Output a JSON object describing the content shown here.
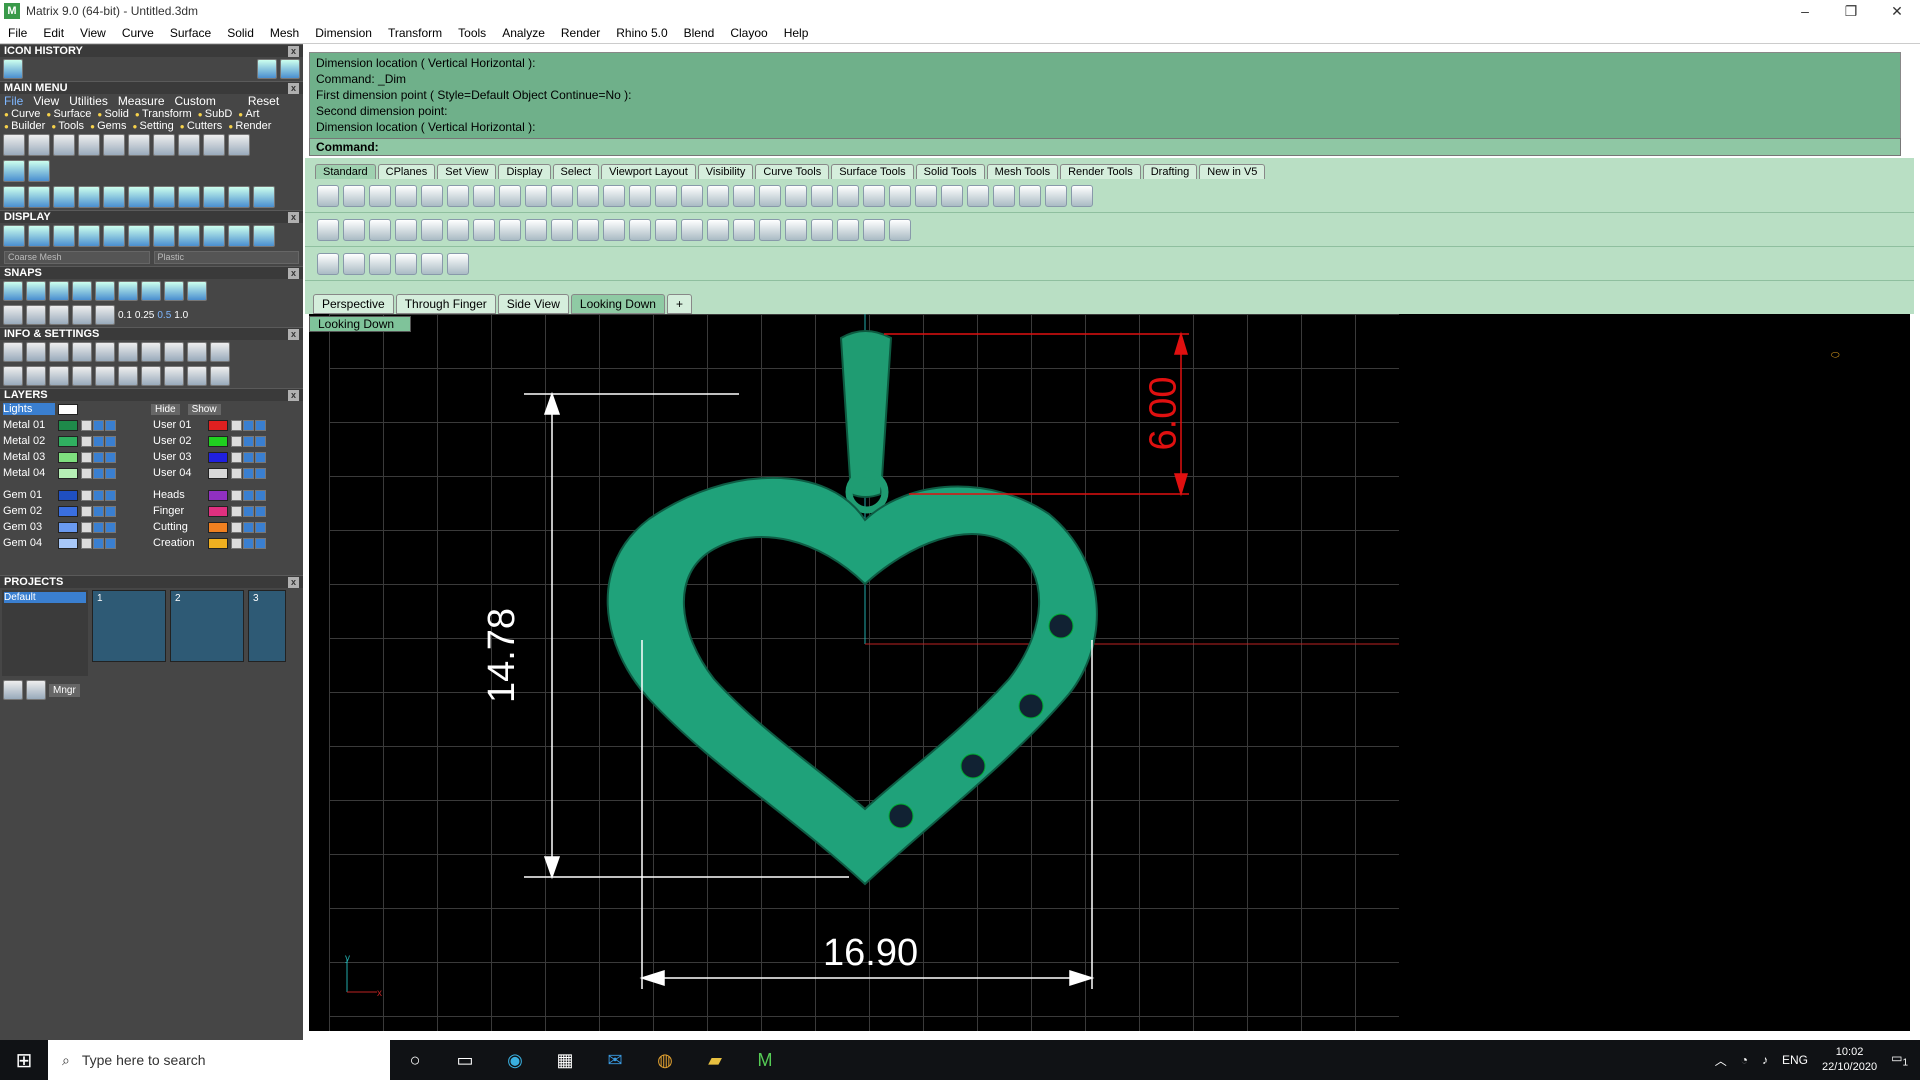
{
  "window": {
    "title": "Matrix 9.0 (64-bit) - Untitled.3dm",
    "app_icon": "matrix-app-icon"
  },
  "menu": [
    "File",
    "Edit",
    "View",
    "Curve",
    "Surface",
    "Solid",
    "Mesh",
    "Dimension",
    "Transform",
    "Tools",
    "Analyze",
    "Render",
    "Rhino 5.0",
    "Blend",
    "Clayoo",
    "Help"
  ],
  "panels": {
    "icon_history": "ICON HISTORY",
    "main_menu": "MAIN MENU",
    "main_menu_items": [
      "File",
      "View",
      "Utilities",
      "Measure",
      "Custom",
      "Reset"
    ],
    "options_row1": [
      "Curve",
      "Surface",
      "Solid",
      "Transform",
      "SubD",
      "Art"
    ],
    "options_row2": [
      "Builder",
      "Tools",
      "Gems",
      "Setting",
      "Cutters",
      "Render"
    ],
    "display": "DISPLAY",
    "mesh_select": "Coarse Mesh",
    "material_select": "Plastic",
    "snaps": "SNAPS",
    "snap_values": [
      "0.1",
      "0.25",
      "0.5",
      "1.0"
    ],
    "info_settings": "INFO & SETTINGS",
    "layers": "LAYERS",
    "lights": "Lights",
    "hide": "Hide",
    "show": "Show",
    "projects": "PROJECTS",
    "project_default": "Default",
    "mngr": "Mngr",
    "thumbs": [
      "1",
      "2",
      "3"
    ]
  },
  "layers_left": [
    {
      "name": "Metal 01",
      "color": "#1e8a4a"
    },
    {
      "name": "Metal 02",
      "color": "#30b060"
    },
    {
      "name": "Metal 03",
      "color": "#7fe07f"
    },
    {
      "name": "Metal 04",
      "color": "#b6f0b6"
    },
    {
      "name": "Gem 01",
      "color": "#1f4fc0"
    },
    {
      "name": "Gem 02",
      "color": "#3a6fe0"
    },
    {
      "name": "Gem 03",
      "color": "#6a9af0"
    },
    {
      "name": "Gem 04",
      "color": "#a8c8f8"
    }
  ],
  "layers_right": [
    {
      "name": "User 01",
      "color": "#e02020"
    },
    {
      "name": "User 02",
      "color": "#20d020"
    },
    {
      "name": "User 03",
      "color": "#2020e0"
    },
    {
      "name": "User 04",
      "color": "#d8d8d8"
    },
    {
      "name": "Heads",
      "color": "#9030c0"
    },
    {
      "name": "Finger",
      "color": "#e03080"
    },
    {
      "name": "Cutting",
      "color": "#f08020"
    },
    {
      "name": "Creation",
      "color": "#f0b020"
    }
  ],
  "command_history": [
    "Dimension location ( Vertical  Horizontal ):",
    "Command: _Dim",
    "First dimension point ( Style=Default  Object  Continue=No ):",
    "Second dimension point:",
    "Dimension location ( Vertical  Horizontal ):"
  ],
  "command_prompt": "Command:",
  "toolbar_tabs": [
    "Standard",
    "CPlanes",
    "Set View",
    "Display",
    "Select",
    "Viewport Layout",
    "Visibility",
    "Curve Tools",
    "Surface Tools",
    "Solid Tools",
    "Mesh Tools",
    "Render Tools",
    "Drafting",
    "New in V5"
  ],
  "view_tabs": [
    "Perspective",
    "Through Finger",
    "Side View",
    "Looking Down"
  ],
  "active_view": "Looking Down",
  "dimensions": {
    "height": "14.78",
    "width": "16.90",
    "bail": "6.00"
  },
  "axis": {
    "y": "y",
    "x": "x"
  },
  "taskbar": {
    "search_placeholder": "Type here to search",
    "lang": "ENG",
    "time": "10:02",
    "date": "22/10/2020",
    "notifications": "1"
  }
}
